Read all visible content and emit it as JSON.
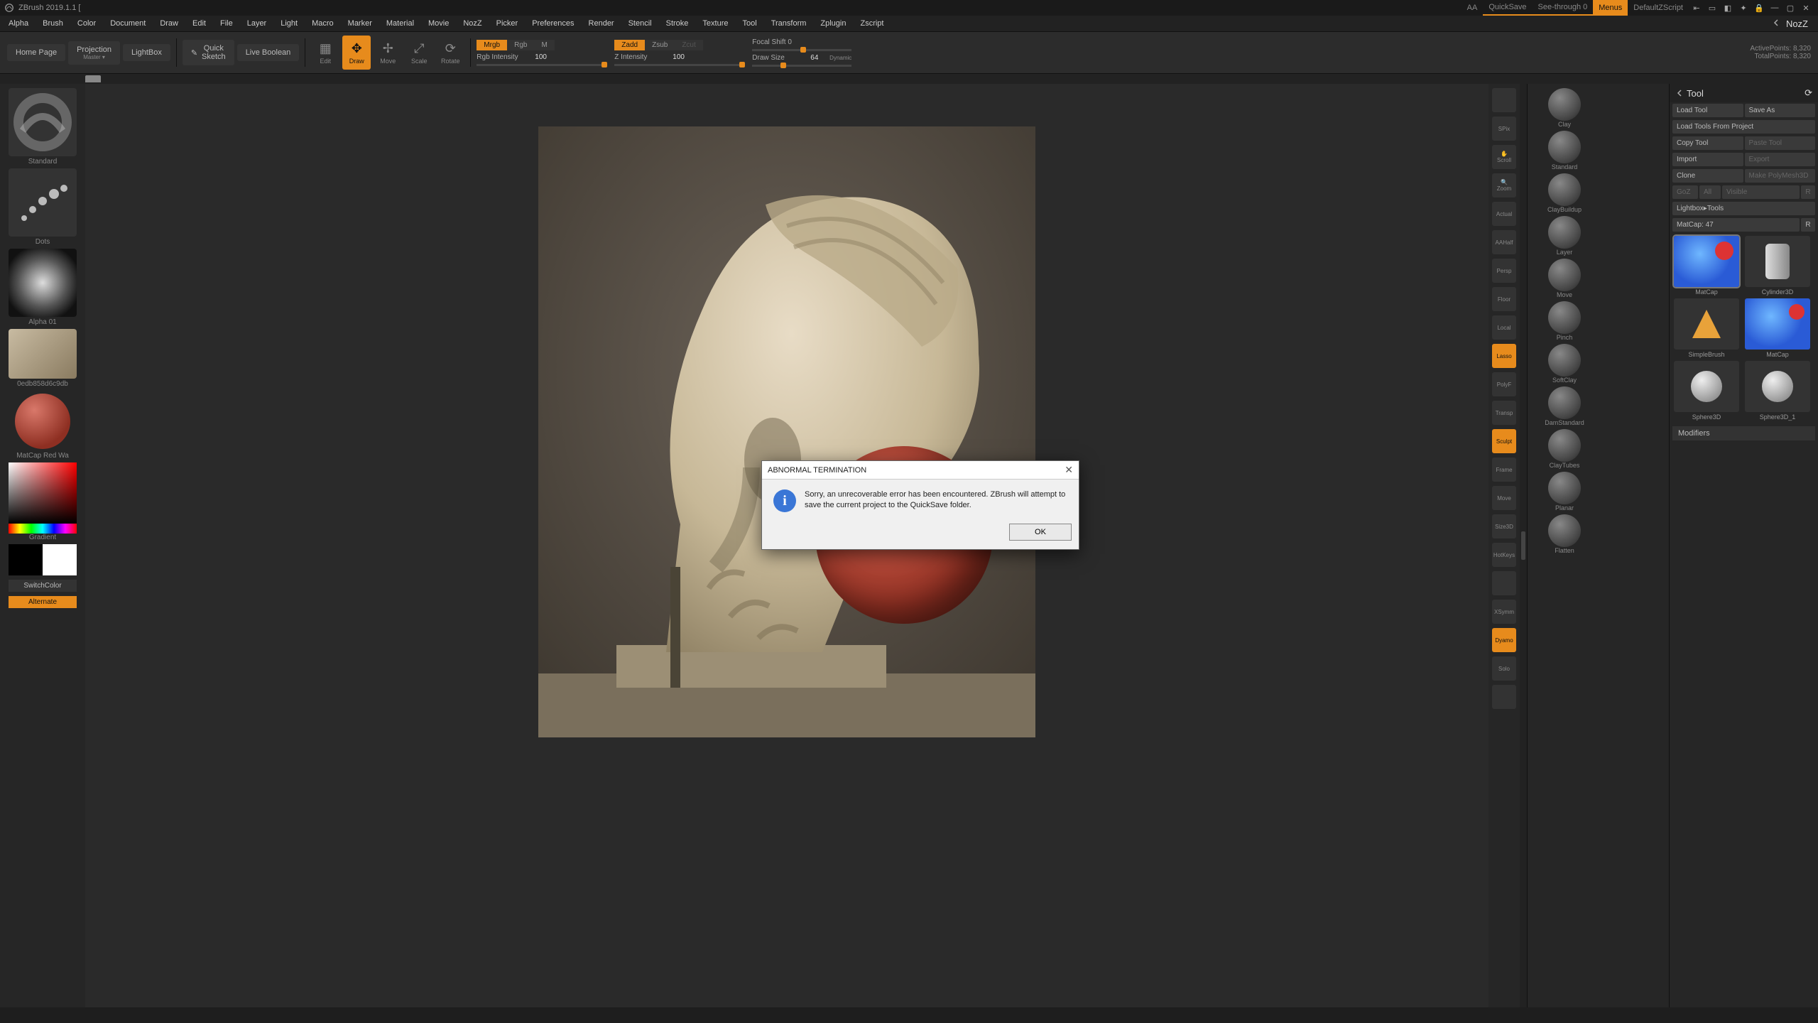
{
  "titlebar": {
    "app": "ZBrush 2019.1.1 [",
    "aa": "AA",
    "quicksave": "QuickSave",
    "seethrough": "See-through  0",
    "menus": "Menus",
    "defaultscript": "DefaultZScript"
  },
  "menu": [
    "Alpha",
    "Brush",
    "Color",
    "Document",
    "Draw",
    "Edit",
    "File",
    "Layer",
    "Light",
    "Macro",
    "Marker",
    "Material",
    "Movie",
    "NozZ",
    "Picker",
    "Preferences",
    "Render",
    "Stencil",
    "Stroke",
    "Texture",
    "Tool",
    "Transform",
    "Zplugin",
    "Zscript"
  ],
  "menu_right": "NozZ",
  "shelf": {
    "home": "Home Page",
    "projection": "Projection",
    "projection_sub": "Master  ▾",
    "lightbox": "LightBox",
    "quicksketch": "Quick",
    "quicksketch2": "Sketch",
    "liveboolean": "Live Boolean",
    "edit": "Edit",
    "draw": "Draw",
    "move": "Move",
    "scale": "Scale",
    "rotate": "Rotate",
    "mode1": {
      "mrgb": "Mrgb",
      "rgb": "Rgb",
      "m": "M"
    },
    "mode2": {
      "zadd": "Zadd",
      "zsub": "Zsub",
      "zcut": "Zcut"
    },
    "focal": "Focal Shift 0",
    "rgb_int": "Rgb Intensity",
    "rgb_int_v": "100",
    "z_int": "Z Intensity",
    "z_int_v": "100",
    "draw_size": "Draw Size",
    "draw_size_v": "64",
    "dynamic": "Dynamic",
    "active": "ActivePoints: 8,320",
    "total": "TotalPoints: 8,320"
  },
  "left": {
    "brush": "Standard",
    "stroke": "Dots",
    "alpha": "Alpha 01",
    "texture": "0edb858d6c9db",
    "material": "MatCap Red Wa",
    "gradient": "Gradient",
    "switch": "SwitchColor",
    "alternate": "Alternate"
  },
  "rrail": [
    "",
    "SPix",
    "Scroll",
    "Zoom",
    "Actual",
    "AAHalf",
    "Persp",
    "Floor",
    "Local",
    "Lasso",
    "PolyF",
    "Transp",
    "Sculpt",
    "Frame",
    "Move",
    "Size3D",
    "HotKeys",
    "",
    "XSymm",
    "Dyamo",
    "Solo",
    ""
  ],
  "rrail_active": [
    9,
    20
  ],
  "brushes": [
    "Clay",
    "Standard",
    "ClayBuildup",
    "Layer",
    "Move",
    "Pinch",
    "SoftClay",
    "DamStandard",
    "ClayTubes",
    "Planar",
    "Flatten"
  ],
  "tool": {
    "title": "Tool",
    "load": "Load Tool",
    "saveas": "Save As",
    "loadfrom": "Load Tools From Project",
    "copy": "Copy Tool",
    "paste": "Paste Tool",
    "import": "Import",
    "export": "Export",
    "clone": "Clone",
    "makepoly": "Make PolyMesh3D",
    "goz": "GoZ",
    "all": "All",
    "visible": "Visible",
    "r1": "R",
    "lightbox": "Lightbox▸Tools",
    "matcap": "MatCap: 47",
    "r2": "R",
    "items": [
      "MatCap",
      "Cylinder3D",
      "SimpleBrush",
      "MatCap",
      "Sphere3D",
      "Sphere3D_1"
    ],
    "modifiers": "Modifiers"
  },
  "dialog": {
    "title": "ABNORMAL TERMINATION",
    "msg": "Sorry, an unrecoverable error has been encountered. ZBrush will attempt to save the current project to the QuickSave folder.",
    "ok": "OK"
  }
}
